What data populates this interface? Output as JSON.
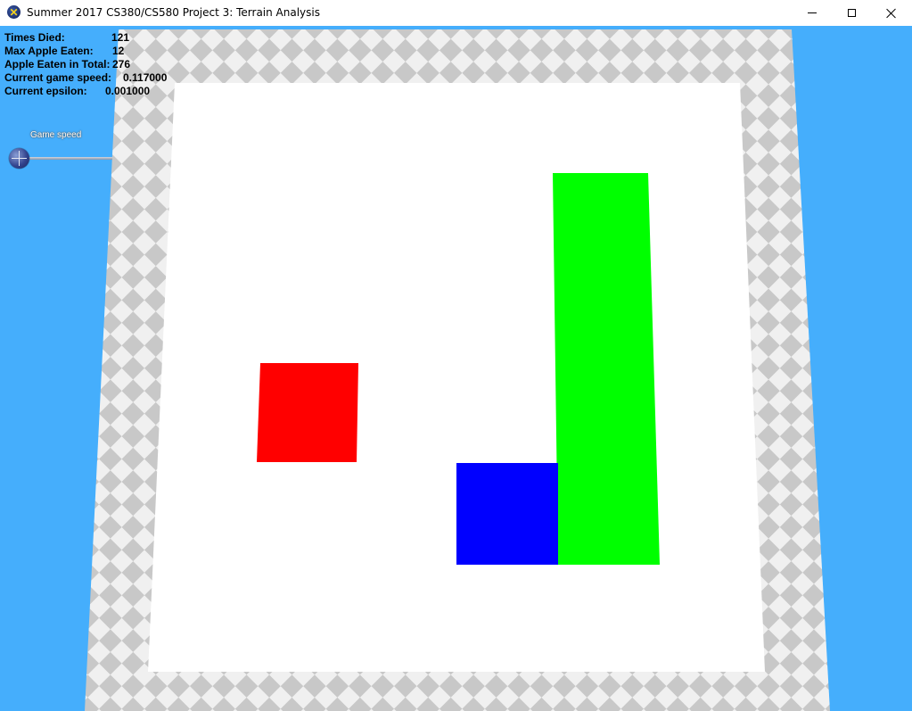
{
  "window": {
    "title": "Summer 2017 CS380/CS580 Project 3: Terrain Analysis",
    "app_icon": "app-logo-icon",
    "controls": [
      "minimize-icon",
      "maximize-icon",
      "close-icon"
    ]
  },
  "hud": {
    "times_died_label": "Times Died:",
    "times_died_value": "121",
    "max_apple_label": "Max Apple Eaten:",
    "max_apple_value": "12",
    "apple_total_label": "Apple Eaten in Total:",
    "apple_total_value": "276",
    "game_speed_label": "Current game speed:",
    "game_speed_value": "0.117000",
    "epsilon_label": "Current epsilon:",
    "epsilon_value": "0.001000"
  },
  "slider": {
    "label": "Game speed",
    "level": 0.0
  },
  "scene": {
    "background_color": "#45aefc",
    "border_tile_light": "#f0f0f0",
    "border_tile_dark": "#c8c8c8",
    "board_color": "#ffffff",
    "apple_color": "#ff0000",
    "snake_head_color": "#0000ff",
    "snake_body_color": "#00ff00"
  }
}
